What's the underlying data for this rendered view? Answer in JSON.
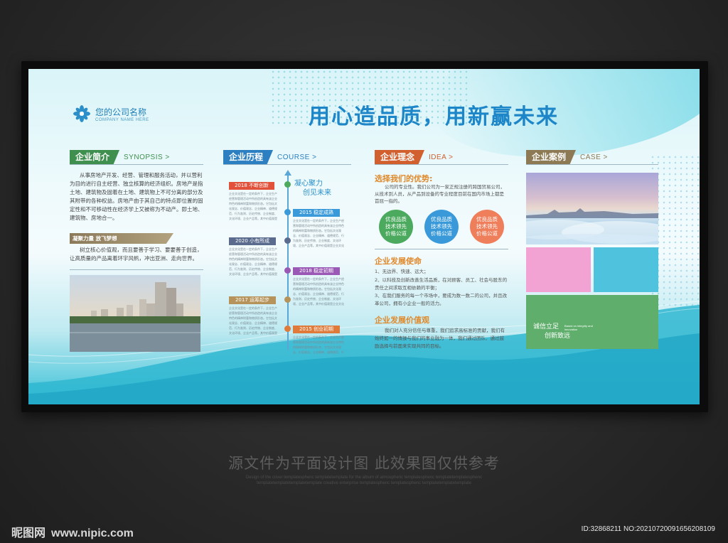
{
  "company": {
    "name_cn": "您的公司名称",
    "name_en": "COMPANY NAME HERE"
  },
  "slogan": "用心造品质，用新赢未来",
  "sections": {
    "intro": {
      "title": "企业简介",
      "en": "SYNOPSIS >",
      "body": "从事房地产开发、经营、管理和服务活动，并以营利为目的进行自主经营、独立核算的经济组织。房地产是指土地、建筑物及固着在土地、建筑物上不可分离的部分及其附带的各种权益。房地产由于其自己的特点即位置的固定性和不可移动性在经济学上又被称为不动产。即土地、建筑物、房地合一。",
      "sub_title": "凝聚力量 放飞梦想",
      "sub_body": "树立核心价值观，而且要善于学习、要要善于创造，让高质量的产品离着环宇风帆，冲出亚洲、走向世界。"
    },
    "course": {
      "title": "企业历程",
      "en": "COURSE >",
      "headline_1": "凝心聚力",
      "headline_2": "创见未来",
      "milestones": [
        {
          "label": "2018 不断创新",
          "color": "#e2523a"
        },
        {
          "label": "2015 稳定成熟",
          "color": "#3a9ad9"
        },
        {
          "label": "2020 小有所成",
          "color": "#5a6b8e"
        },
        {
          "label": "2018 稳定初期",
          "color": "#9b59b6"
        },
        {
          "label": "2017 运筹起步",
          "color": "#b5935a"
        },
        {
          "label": "2015 创业初期",
          "color": "#e07a3a"
        }
      ],
      "milestone_text": "企业文化是在一定的条件下，企业生产经营和管理活动中所创造的具有该企业特色的精神财富和物质形态。它包括文化观念、价值观念、企业精神、道德规范、行为准则、历史传统、企业制度、文化环境、企业产品等。其中价值观是企业文化的核心。"
    },
    "idea": {
      "title": "企业理念",
      "en": "IDEA >",
      "adv_title": "选择我们的优势:",
      "adv_body": "公司的专业性。我们公司为一家正规注册的跨国贸易公司，从技术到人员，从产品到设备的专业程度目前在国内市场上都是首屈一指的。",
      "circles": [
        {
          "text": "优良品质 技术领先 价格公道",
          "color": "#4caa5e"
        },
        {
          "text": "优良品质 技术领先 价格公道",
          "color": "#3a9ad9"
        },
        {
          "text": "优良品质 技术领先 价格公道",
          "color": "#ef7e5b"
        }
      ],
      "mission_title": "企业发展使命",
      "mission_items": [
        "1、无边界、快速、远大；",
        "2、以科技及创新改善生活品质，在对顾客、员工、社会与股东的责任之间求取互相依赖的平衡；",
        "3、在我们服务的每一个市场中，要成为数一数二的公司，并且改革公司，拥有小企业一般的活力。"
      ],
      "value_title": "企业发展价值观",
      "value_body": "我们对人充分信任与尊重，我们追求高标准的贡献，我们有始终如一的情操与我们的事业融为一体，我们通过团队、通过鼓励选择与前面来实现共同的目标。"
    },
    "case": {
      "title": "企业案例",
      "en": "CASE >",
      "motto_1": "诚信立足",
      "motto_2": "创新致远",
      "motto_en": "Based on integrity and innovation"
    }
  },
  "caption": "源文件为平面设计图 此效果图仅供参考",
  "caption_en": "Design of the cover templatesphenc templatetemplate for the album of atmospheric templatesphenc templatetemplatesphenc templatetemplatetemplatetemplate creative enterprise templatesphenc templatesphenc templatetemplatetemplate",
  "watermark": {
    "site_cn": "昵图网",
    "site_url": "www.nipic.com",
    "id": "ID:32868211 NO:20210720091656208109"
  },
  "colors": {
    "green": "#3f8f4f",
    "blue": "#2c7fc1",
    "orange": "#d2602f",
    "brown": "#8d7a55"
  }
}
